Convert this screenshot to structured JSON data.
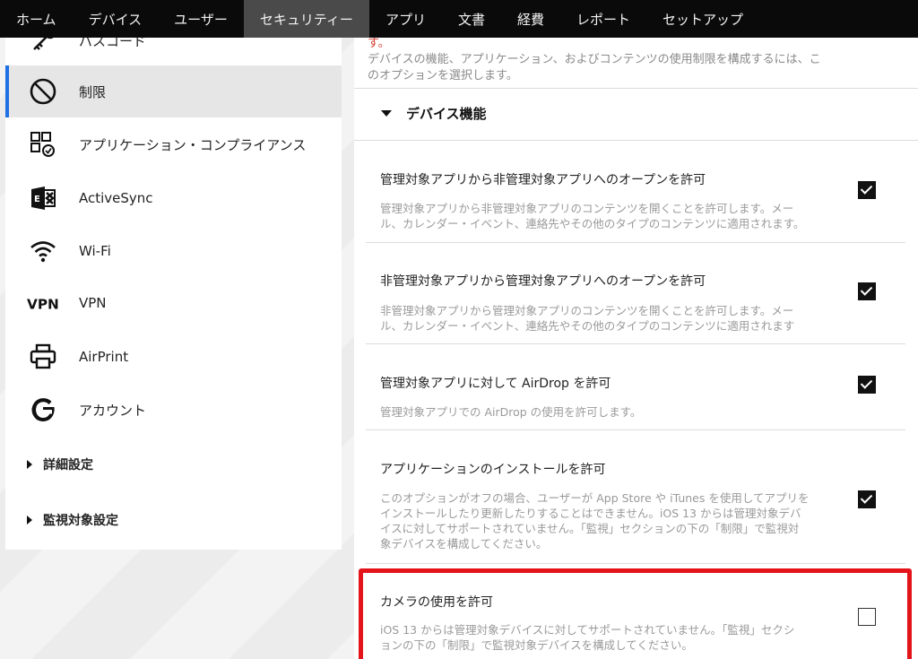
{
  "nav": {
    "tabs": [
      {
        "label": "ホーム"
      },
      {
        "label": "デバイス"
      },
      {
        "label": "ユーザー"
      },
      {
        "label": "セキュリティー"
      },
      {
        "label": "アプリ"
      },
      {
        "label": "文書"
      },
      {
        "label": "経費"
      },
      {
        "label": "レポート"
      },
      {
        "label": "セットアップ"
      }
    ],
    "active_index": 3
  },
  "sidebar": {
    "items": [
      {
        "label": "パスコード",
        "icon": "key-icon"
      },
      {
        "label": "制限",
        "icon": "restriction-icon",
        "active": true
      },
      {
        "label": "アプリケーション・コンプライアンス",
        "icon": "app-compliance-icon"
      },
      {
        "label": "ActiveSync",
        "icon": "exchange-icon"
      },
      {
        "label": "Wi-Fi",
        "icon": "wifi-icon"
      },
      {
        "label": "VPN",
        "icon": "vpn-icon"
      },
      {
        "label": "AirPrint",
        "icon": "printer-icon"
      },
      {
        "label": "アカウント",
        "icon": "google-icon"
      }
    ],
    "sections": [
      {
        "label": "詳細設定"
      },
      {
        "label": "監視対象設定"
      }
    ],
    "accent_color": "#1f6fe5"
  },
  "main": {
    "intro_line1": "す。",
    "intro_line2": "デバイスの機能、アプリケーション、およびコンテンツの使用制限を構成するには、こ",
    "intro_line3": "のオプションを選択します。",
    "section_title": "デバイス機能",
    "items": [
      {
        "title": "管理対象アプリから非管理対象アプリへのオープンを許可",
        "desc_lines": [
          "管理対象アプリから非管理対象アプリのコンテンツを開くことを許可します。メー",
          "ル、カレンダー・イベント、連絡先やその他のタイプのコンテンツに適用されます。"
        ],
        "checked": true
      },
      {
        "title": "非管理対象アプリから管理対象アプリへのオープンを許可",
        "desc_lines": [
          "非管理対象アプリから管理対象アプリのコンテンツを開くことを許可します。メー",
          "ル、カレンダー・イベント、連絡先やその他のタイプのコンテンツに適用されます"
        ],
        "checked": true
      },
      {
        "title": "管理対象アプリに対して AirDrop を許可",
        "desc_lines": [
          "管理対象アプリでの AirDrop の使用を許可します。"
        ],
        "checked": true
      },
      {
        "title": "アプリケーションのインストールを許可",
        "desc_lines": [
          "このオプションがオフの場合、ユーザーが App Store や iTunes を使用してアプリを",
          "インストールしたり更新したりすることはできません。iOS 13 からは管理対象デバ",
          "イスに対してサポートされていません。「監視」セクションの下の「制限」で監視対",
          "象デバイスを構成してください。"
        ],
        "checked": true
      },
      {
        "title": "カメラの使用を許可",
        "desc_lines": [
          "iOS 13 からは管理対象デバイスに対してサポートされていません。「監視」セクシ",
          "ョンの下の「制限」で監視対象デバイスを構成してください。"
        ],
        "checked": false
      }
    ],
    "highlight_color": "#e4141b"
  }
}
